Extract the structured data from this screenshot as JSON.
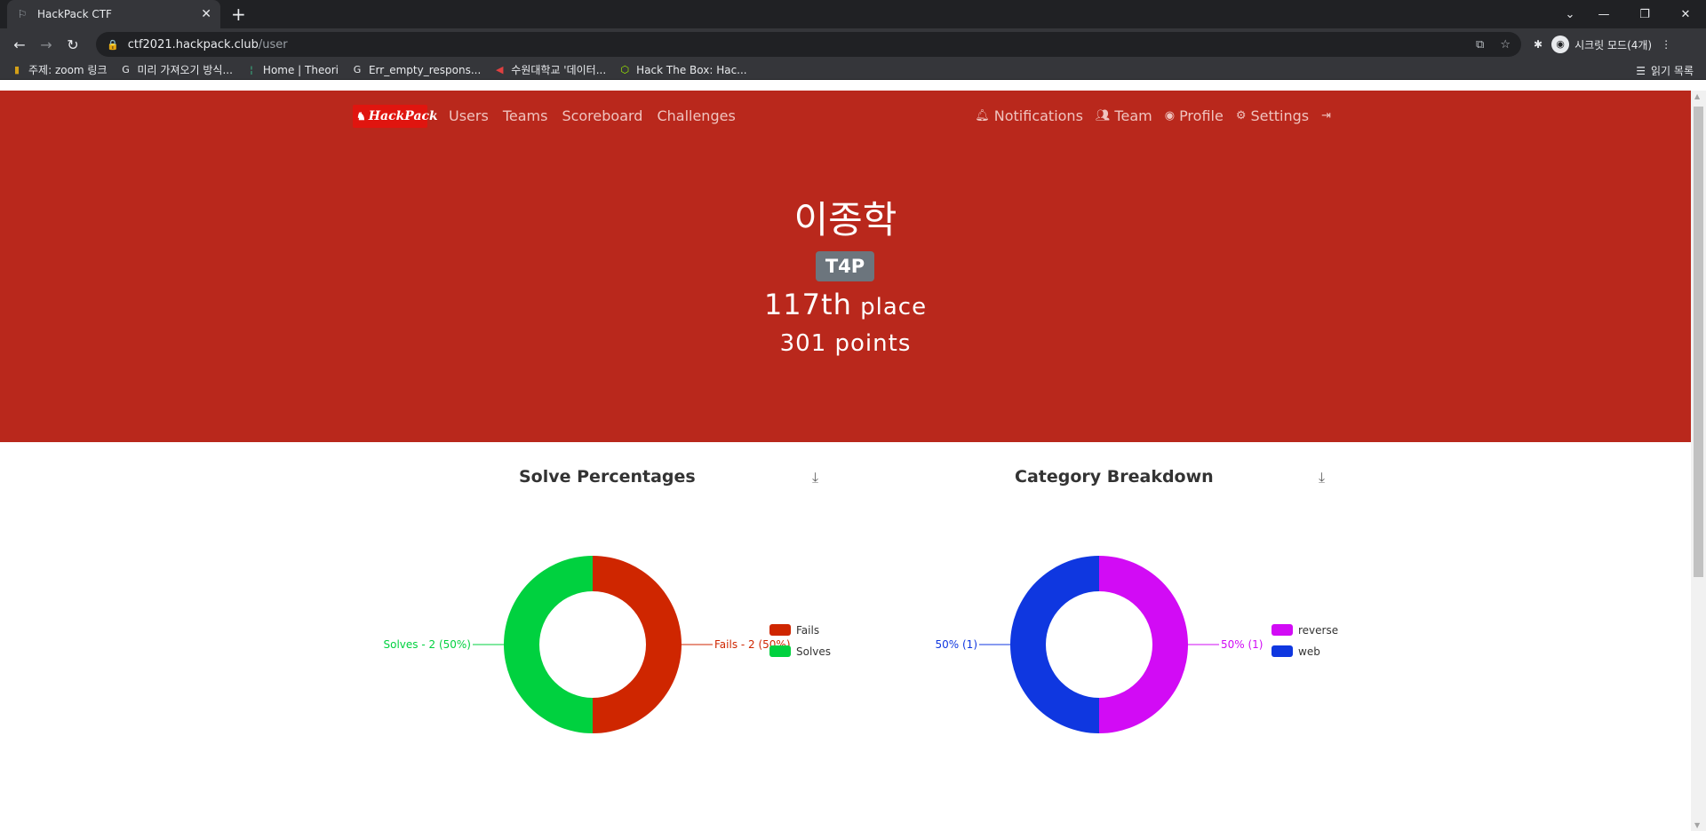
{
  "browser": {
    "tab_title": "HackPack CTF",
    "url_host": "ctf2021.hackpack.club",
    "url_path": "/user",
    "incognito_label": "시크릿 모드(4개)",
    "reading_list": "읽기 목록",
    "bookmarks": [
      {
        "icon": "zoom-icon",
        "label": "주제: zoom 링크"
      },
      {
        "icon": "google-icon",
        "label": "미리 가져오기 방식..."
      },
      {
        "icon": "theori-icon",
        "label": "Home | Theori"
      },
      {
        "icon": "google-icon",
        "label": "Err_empty_respons..."
      },
      {
        "icon": "megaphone-icon",
        "label": "수원대학교 '데이터..."
      },
      {
        "icon": "htb-icon",
        "label": "Hack The Box: Hac..."
      }
    ]
  },
  "site": {
    "logo_text": "HackPack",
    "nav_left": [
      "Users",
      "Teams",
      "Scoreboard",
      "Challenges"
    ],
    "nav_right": {
      "notifications": "Notifications",
      "team": "Team",
      "profile": "Profile",
      "settings": "Settings"
    },
    "brand_color": "#b9281c"
  },
  "profile": {
    "name": "이종학",
    "team": "T4P",
    "place_num": "117th",
    "place_word": "place",
    "points": "301 points"
  },
  "chart_data": [
    {
      "type": "pie",
      "title": "Solve Percentages",
      "donut": true,
      "slices": [
        {
          "name": "Fails",
          "value": 2,
          "label": "Fails - 2 (50%)",
          "color": "#cf2600"
        },
        {
          "name": "Solves",
          "value": 2,
          "label": "Solves - 2 (50%)",
          "color": "#00d13f"
        }
      ],
      "legend": "right"
    },
    {
      "type": "pie",
      "title": "Category Breakdown",
      "donut": true,
      "slices": [
        {
          "name": "reverse",
          "value": 1,
          "label": "50% (1)",
          "color": "#d20bf5"
        },
        {
          "name": "web",
          "value": 1,
          "label": "50% (1)",
          "color": "#0f37e0"
        }
      ],
      "legend": "right"
    }
  ]
}
